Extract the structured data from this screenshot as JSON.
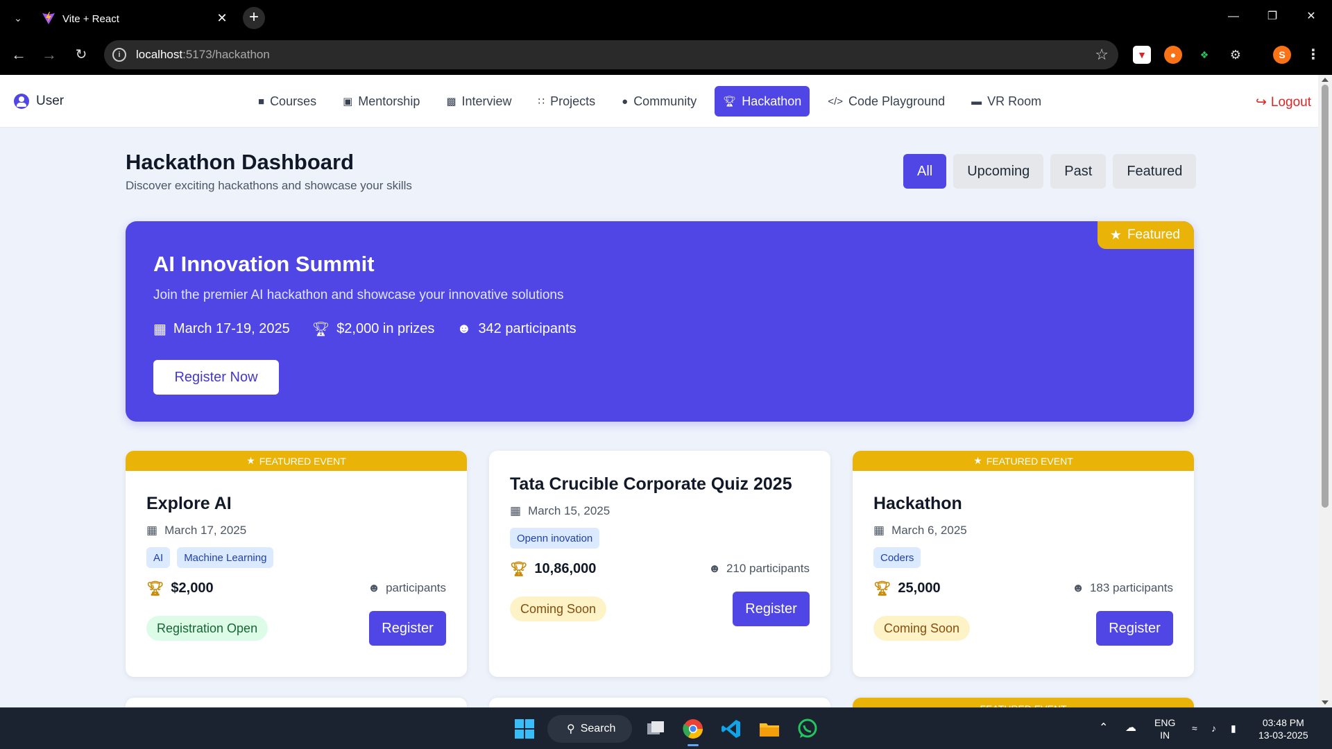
{
  "browser": {
    "tab_title": "Vite + React",
    "url_host": "localhost",
    "url_rest": ":5173/hackathon",
    "profile_initial": "S"
  },
  "navbar": {
    "user_label": "User",
    "links": [
      {
        "label": "Courses",
        "icon": "book-icon"
      },
      {
        "label": "Mentorship",
        "icon": "chalkboard-icon"
      },
      {
        "label": "Interview",
        "icon": "briefcase-icon"
      },
      {
        "label": "Projects",
        "icon": "project-diagram-icon"
      },
      {
        "label": "Community",
        "icon": "comments-icon"
      },
      {
        "label": "Hackathon",
        "icon": "trophy-icon",
        "active": true
      },
      {
        "label": "Code Playground",
        "icon": "code-icon"
      },
      {
        "label": "VR Room",
        "icon": "vr-headset-icon"
      }
    ],
    "logout_label": "Logout"
  },
  "dashboard": {
    "title": "Hackathon Dashboard",
    "subtitle": "Discover exciting hackathons and showcase your skills",
    "filters": [
      "All",
      "Upcoming",
      "Past",
      "Featured"
    ],
    "active_filter": "All"
  },
  "hero": {
    "badge": "Featured",
    "title": "AI Innovation Summit",
    "description": "Join the premier AI hackathon and showcase your innovative solutions",
    "date": "March 17-19, 2025",
    "prizes": "$2,000 in prizes",
    "participants": "342 participants",
    "button": "Register Now"
  },
  "cards": [
    {
      "ribbon": "FEATURED EVENT",
      "title": "Explore AI",
      "date": "March 17, 2025",
      "tags": [
        "AI",
        "Machine Learning"
      ],
      "prize": "$2,000",
      "participants": "participants",
      "status": "Registration Open",
      "button": "Register"
    },
    {
      "ribbon": "",
      "title": "Tata Crucible Corporate Quiz 2025",
      "date": "March 15, 2025",
      "tags": [
        "Openn inovation"
      ],
      "prize": "10,86,000",
      "participants": "210 participants",
      "status": "Coming Soon",
      "button": "Register"
    },
    {
      "ribbon": "FEATURED EVENT",
      "title": "Hackathon",
      "date": "March 6, 2025",
      "tags": [
        "Coders"
      ],
      "prize": "25,000",
      "participants": "183 participants",
      "status": "Coming Soon",
      "button": "Register"
    }
  ],
  "peek_ribbon": "FEATURED EVENT",
  "taskbar": {
    "search_label": "Search",
    "lang_line1": "ENG",
    "lang_line2": "IN",
    "time": "03:48 PM",
    "date": "13-03-2025"
  },
  "colors": {
    "accent": "#4f46e5",
    "featured": "#eab308",
    "logout": "#dc2626"
  }
}
